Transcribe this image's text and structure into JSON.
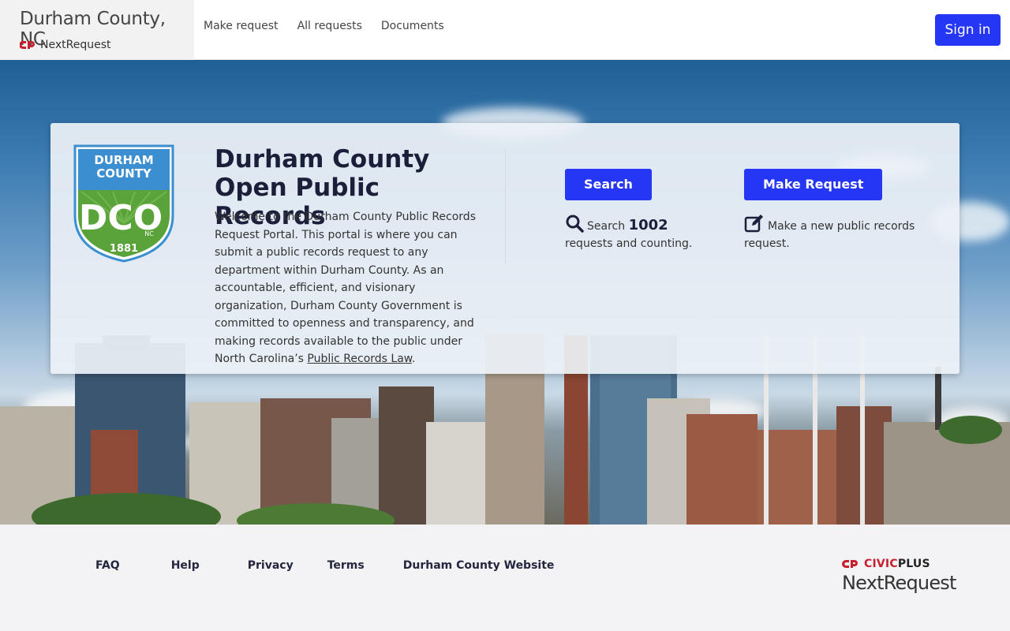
{
  "header": {
    "site_title": "Durham County, NC",
    "platform_name": "NextRequest",
    "nav": [
      "Make request",
      "All requests",
      "Documents"
    ],
    "signin_label": "Sign in"
  },
  "seal": {
    "line1": "DURHAM",
    "line2": "COUNTY",
    "monogram": "DCO",
    "state": "NC",
    "year": "1881"
  },
  "intro": {
    "title": "Durham County Open Public Records",
    "body": "Welcome to the Durham County Public Records Request Portal. This portal is where you can submit a public records request to any department within Durham County. As an accountable, efficient, and visionary organization, Durham County Government is committed to openness and transparency, and making records available to the public under North Carolina’s ",
    "link_text": "Public Records Law",
    "end": "."
  },
  "search": {
    "button_label": "Search",
    "prefix": "Search",
    "count": "1002",
    "suffix": "requests and counting."
  },
  "make_request": {
    "button_label": "Make Request",
    "desc": "Make a new public records request."
  },
  "footer": {
    "links": [
      "FAQ",
      "Help",
      "Privacy",
      "Terms",
      "Durham County Website"
    ],
    "brand_civic": "CIVIC",
    "brand_plus": "PLUS",
    "brand_name": "NextRequest"
  },
  "colors": {
    "primary": "#2536f4",
    "title_dark": "#1c1f3a",
    "seal_blue": "#3b8fd1",
    "seal_green": "#5aa23a",
    "civic_red": "#c7202f"
  },
  "icons": [
    "nextrequest-logo-icon",
    "search-icon",
    "edit-icon",
    "civicplus-logo-icon"
  ]
}
